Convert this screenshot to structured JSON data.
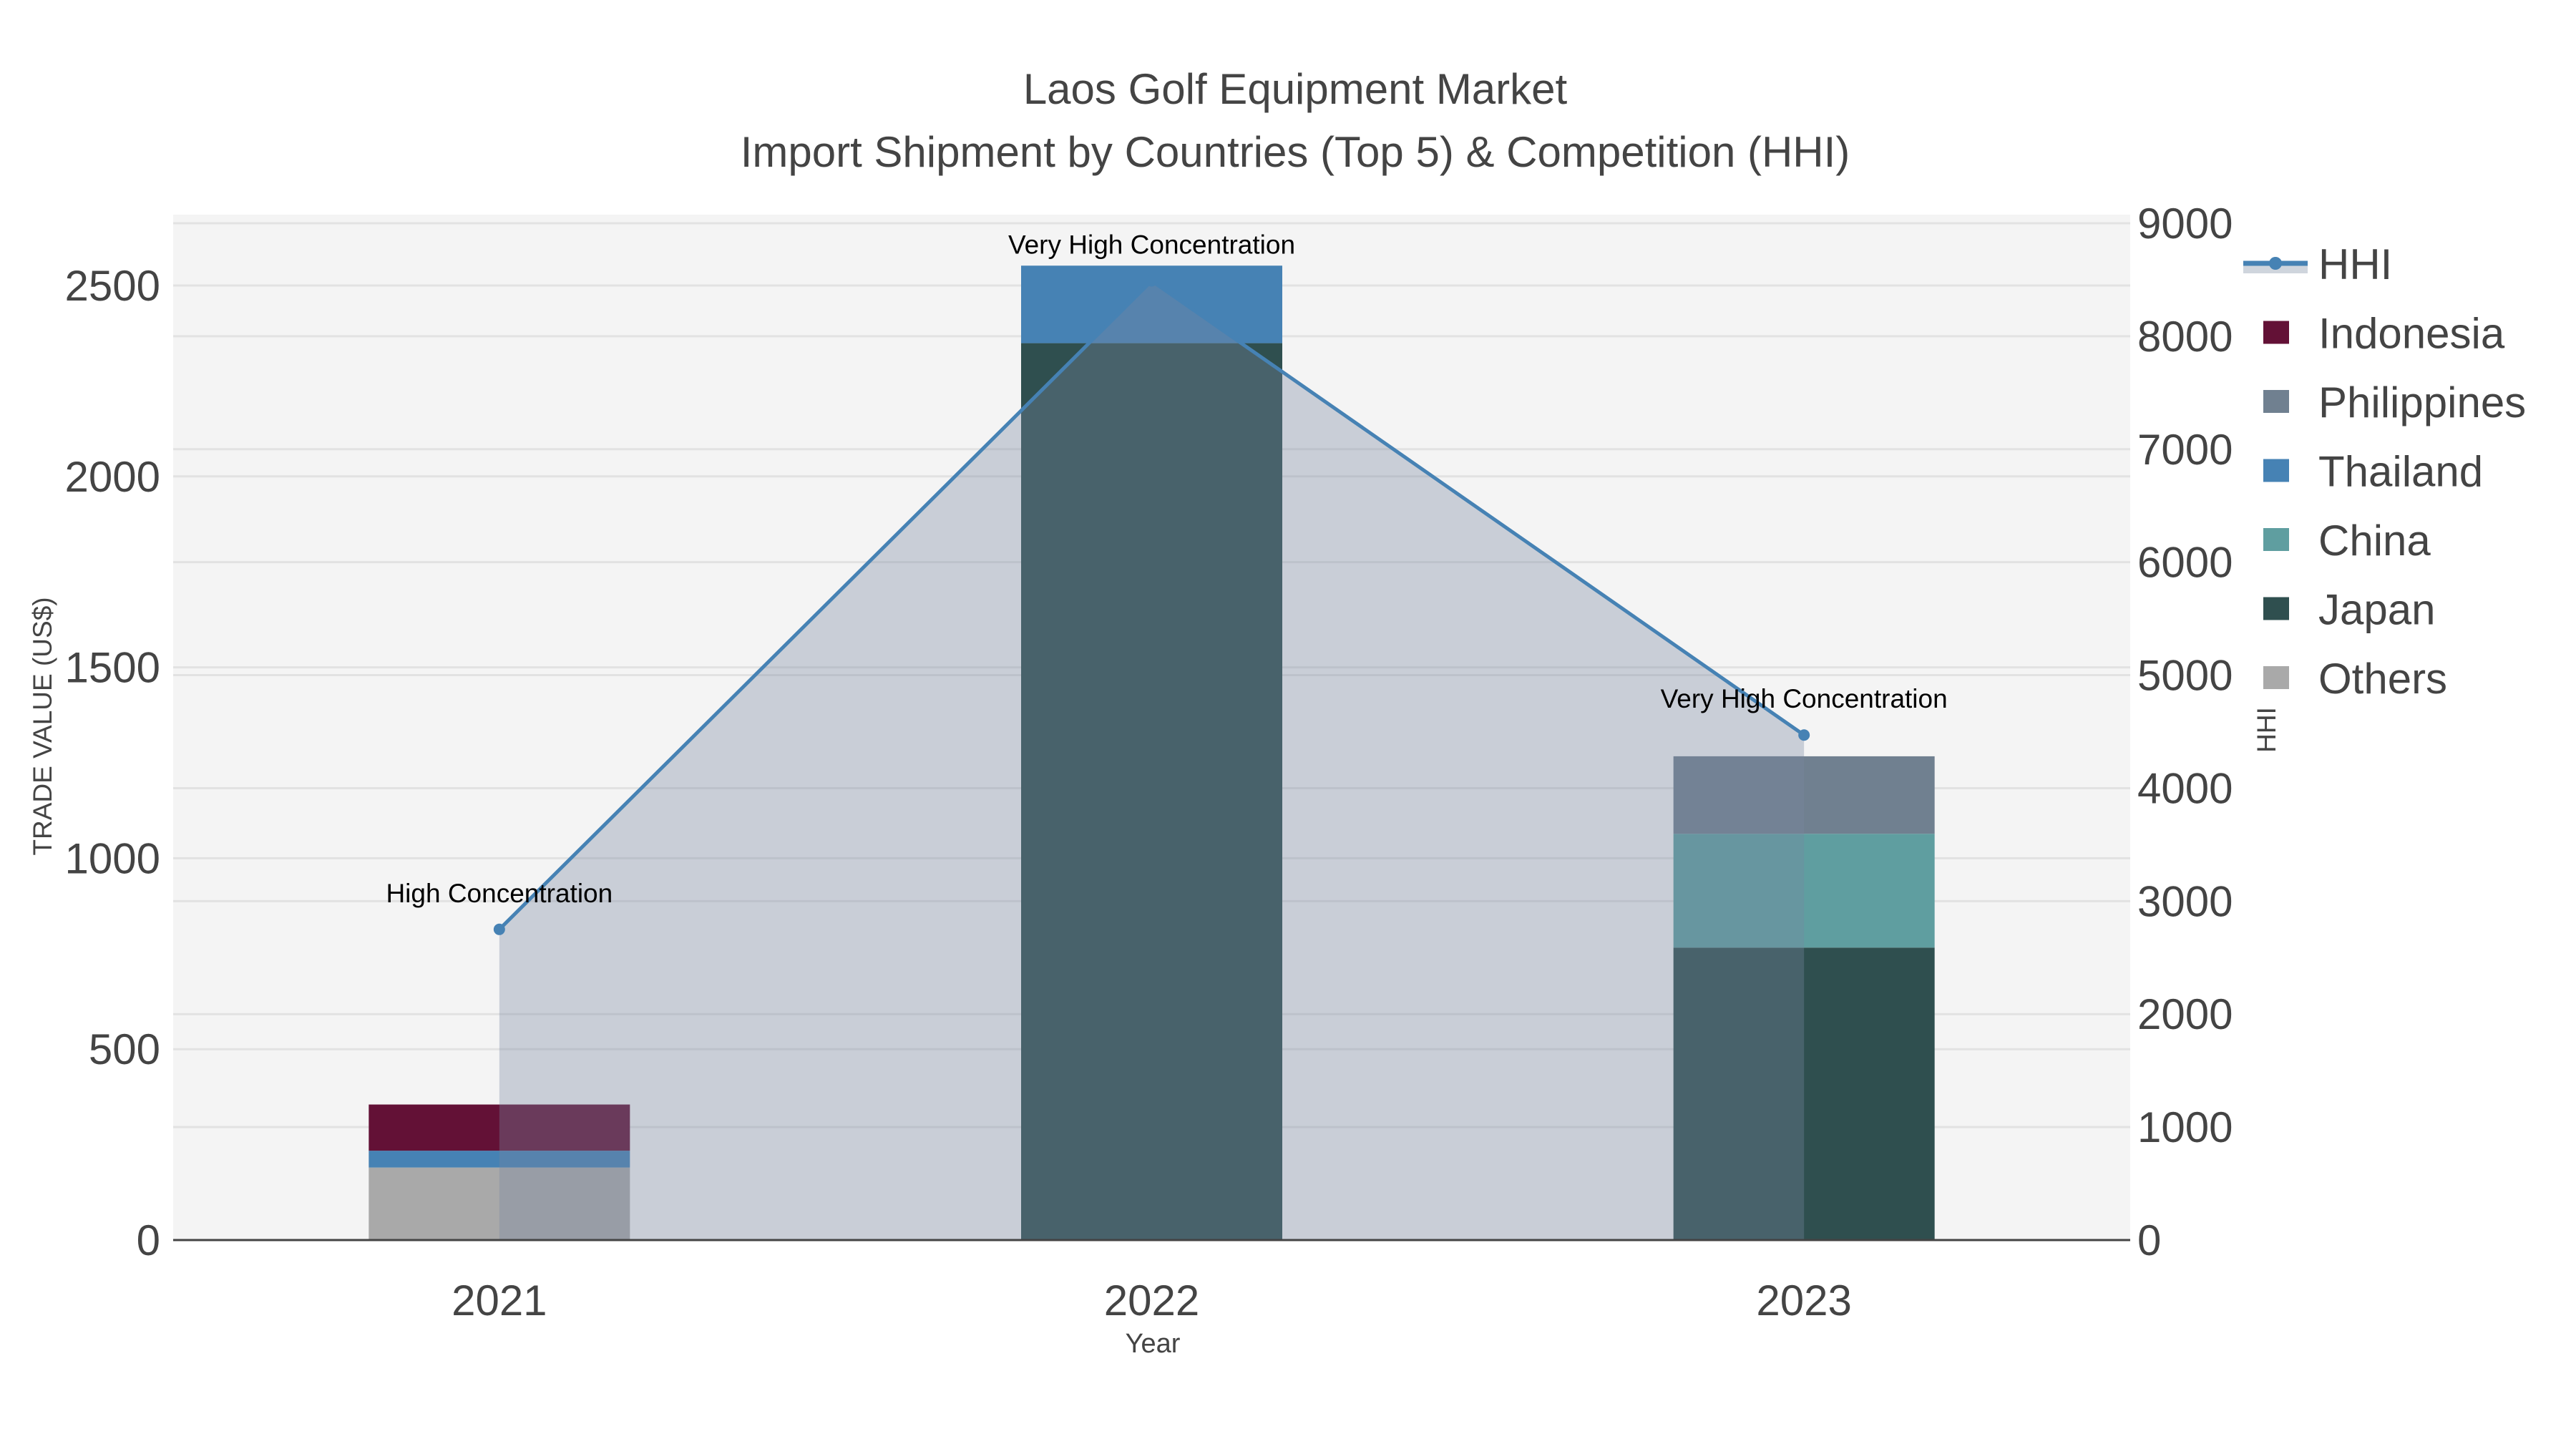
{
  "chart_data": {
    "type": "bar",
    "title": "Laos Golf Equipment Market",
    "subtitle": "Import Shipment by Countries (Top 5) & Competition (HHI)",
    "xlabel": "Year",
    "ylabel": "TRADE VALUE (US$)",
    "y2label": "HHI",
    "categories": [
      "2021",
      "2022",
      "2023"
    ],
    "ylim": [
      0,
      2680
    ],
    "y2lim": [
      0,
      9050
    ],
    "yticks": [
      0,
      500,
      1000,
      1500,
      2000,
      2500
    ],
    "y2ticks": [
      0,
      1000,
      2000,
      3000,
      4000,
      5000,
      6000,
      7000,
      8000,
      9000
    ],
    "stack_order": [
      "Others",
      "Japan",
      "China",
      "Thailand",
      "Philippines",
      "Indonesia"
    ],
    "series": [
      {
        "name": "Indonesia",
        "color": "#631136",
        "values": [
          121,
          0,
          0
        ]
      },
      {
        "name": "Philippines",
        "color": "#708090",
        "values": [
          0,
          0,
          203
        ]
      },
      {
        "name": "Thailand",
        "color": "#4682B4",
        "values": [
          44,
          203,
          0
        ]
      },
      {
        "name": "China",
        "color": "#5F9EA0",
        "values": [
          0,
          0,
          298
        ]
      },
      {
        "name": "Japan",
        "color": "#2F4F4F",
        "values": [
          0,
          2349,
          766
        ]
      },
      {
        "name": "Others",
        "color": "#A9A9A9",
        "values": [
          190,
          0,
          0
        ]
      }
    ],
    "hhi": {
      "name": "HHI",
      "color": "#4682B4",
      "values": [
        2750,
        8490,
        4470
      ]
    },
    "annotations": [
      "High Concentration",
      "Very High Concentration",
      "Very High Concentration"
    ],
    "legend_position": "right",
    "grid": true
  }
}
